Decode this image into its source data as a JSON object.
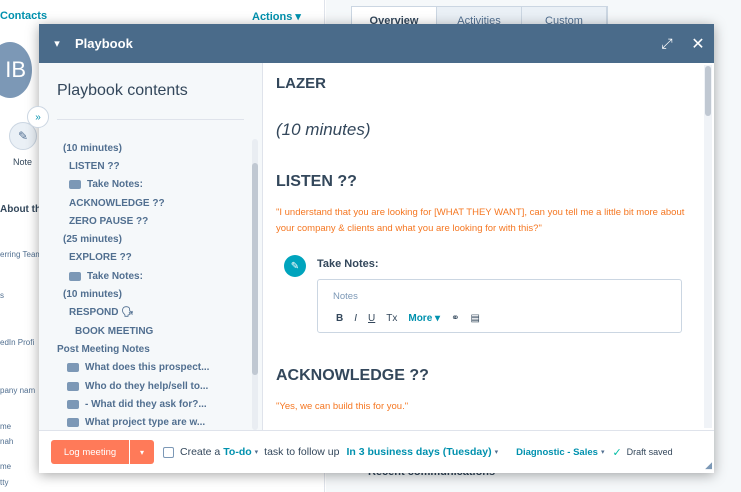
{
  "background": {
    "contacts_link": "Contacts",
    "actions_label": "Actions",
    "avatar_initials": "IB",
    "note_label": "Note",
    "about_heading": "About th",
    "side_labels": [
      "erring Team",
      "s",
      "edIn Profi",
      "pany nam",
      "me",
      "nah",
      "me",
      "tty"
    ],
    "tabs": [
      "Overview",
      "Activities",
      "Custom"
    ],
    "recent_label": "Recent communications"
  },
  "modal": {
    "title": "Playbook",
    "toc": {
      "heading": "Playbook contents",
      "items": [
        {
          "label": "(10 minutes)",
          "level": "lvl1",
          "icon": false
        },
        {
          "label": "LISTEN ??",
          "level": "lvl1b",
          "icon": false
        },
        {
          "label": "Take Notes:",
          "level": "lvl1b",
          "icon": true
        },
        {
          "label": "ACKNOWLEDGE ??",
          "level": "lvl1b",
          "icon": false
        },
        {
          "label": "ZERO PAUSE ??",
          "level": "lvl1b",
          "icon": false
        },
        {
          "label": "(25 minutes)",
          "level": "lvl1",
          "icon": false
        },
        {
          "label": "EXPLORE ??",
          "level": "lvl1b",
          "icon": false
        },
        {
          "label": "Take Notes:",
          "level": "lvl1b",
          "icon": true
        },
        {
          "label": "(10 minutes)",
          "level": "lvl1",
          "icon": false
        },
        {
          "label": "RESPOND 🗣",
          "level": "lvl1b",
          "icon": false
        },
        {
          "label": "BOOK MEETING",
          "level": "lvl2b",
          "icon": false
        },
        {
          "label": "Post Meeting Notes",
          "level": "lvl0",
          "icon": false
        },
        {
          "label": "What does this prospect...",
          "level": "lvl2",
          "icon": true
        },
        {
          "label": "Who do they help/sell to...",
          "level": "lvl2",
          "icon": true
        },
        {
          "label": "- What did they ask for?...",
          "level": "lvl2",
          "icon": true
        },
        {
          "label": "What project type are w...",
          "level": "lvl2",
          "icon": true
        }
      ]
    },
    "content": {
      "heading_main": "LAZER",
      "duration": "(10 minutes)",
      "heading_listen": "LISTEN ??",
      "quote_listen": "\"I understand that you are looking for [WHAT THEY WANT], can you tell me a little bit more about your company & clients and what you are looking for with this?\"",
      "notes_label": "Take Notes:",
      "notes_placeholder": "Notes",
      "toolbar": {
        "bold": "B",
        "italic": "I",
        "underline": "U",
        "clear": "Tx",
        "more": "More"
      },
      "heading_ack": "ACKNOWLEDGE ??",
      "quote_ack": "\"Yes, we can build this for you.\""
    },
    "footer": {
      "log_button": "Log meeting",
      "create_text": "Create a",
      "todo_link": "To-do",
      "follow_text": "task to follow up",
      "due_link": "In 3 business days (Tuesday)",
      "pipeline_link": "Diagnostic - Sales",
      "saved_text": "Draft saved"
    }
  },
  "colors": {
    "header": "#4a6b8a",
    "accent_orange": "#ff7a59",
    "quote_orange": "#f57722",
    "link_teal": "#0091ae",
    "notes_icon": "#00a4bd"
  }
}
